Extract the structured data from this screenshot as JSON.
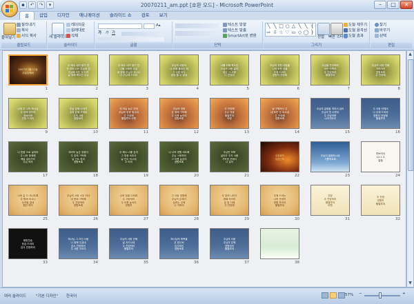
{
  "window": {
    "title": "20070211_am.ppt [호환 모드] - Microsoft PowerPoint",
    "controls": {
      "minimize": "–",
      "maximize": "□",
      "close": "×"
    }
  },
  "quick_access": {
    "save": "▪",
    "undo": "↶",
    "redo": "↷",
    "more": "▾"
  },
  "tabs": [
    "홈",
    "삽입",
    "디자인",
    "애니메이션",
    "슬라이드 쇼",
    "검토",
    "보기"
  ],
  "ribbon": {
    "clipboard": {
      "label": "클립보드",
      "paste": "붙여넣기",
      "cut": "잘라내기",
      "copy": "복사",
      "format_painter": "서식 복사"
    },
    "slides": {
      "label": "슬라이드",
      "new_slide": "새 슬라이드",
      "layout": "레이아웃",
      "reset": "원래대로",
      "delete": "삭제"
    },
    "font": {
      "label": "글꼴",
      "bold": "가",
      "italic": "가",
      "underline": "가"
    },
    "paragraph": {
      "label": "단락",
      "text_direction": "텍스트 방향",
      "align_text": "텍스트 맞춤",
      "smartart": "SmartArt로 변환"
    },
    "drawing": {
      "label": "그리기",
      "arrange": "정렬",
      "quick_styles": "빠른 스타일",
      "shape_fill": "도형 채우기",
      "shape_outline": "도형 윤곽선",
      "shape_effects": "도형 효과"
    },
    "editing": {
      "label": "편집",
      "find": "찾기",
      "replace": "바꾸기",
      "select": "선택"
    }
  },
  "slides": [
    {
      "n": 1,
      "fill": "cross",
      "lines": [
        "2007년 2월 11일",
        "주일낮예배"
      ]
    },
    {
      "n": 2,
      "fill": "yellow",
      "lines": [
        "주 예수 내가 알기 전",
        "전 부터 나는 주님의 것",
        "주님께 모든 것 드려",
        "날 위해 죽으신 주님"
      ]
    },
    {
      "n": 3,
      "fill": "yellow",
      "lines": [
        "주 예수 내가 알기 전",
        "나를 사랑한 주님",
        "내 맘에 주님이 계시니",
        "나 주님께 드리리"
      ]
    },
    {
      "n": 4,
      "fill": "yellow",
      "lines": [
        "주님의 사랑이",
        "나 위해 흘리신 피",
        "그 사랑 모두",
        "감당 할 수 없네"
      ]
    },
    {
      "n": 5,
      "fill": "yellow",
      "lines": [
        "나를 위해 죽으신",
        "주님의 사랑 끝이",
        "없는 그 사랑",
        "나 받았네"
      ]
    },
    {
      "n": 6,
      "fill": "yellow",
      "lines": [
        "주님의 귀한 사랑을",
        "나의 모든 것을",
        "주께 드리리",
        "영원히 찬양해"
      ]
    },
    {
      "n": 7,
      "fill": "yellow",
      "lines": [
        "주님을 찬양하라",
        "모든 민족아",
        "주 찬양하라",
        "할렐루야"
      ]
    },
    {
      "n": 8,
      "fill": "yellow",
      "lines": [
        "주님의 사랑 안에",
        "거하리라",
        "영원토록",
        "주 찬양해"
      ]
    },
    {
      "n": 9,
      "fill": "yellow",
      "lines": [
        "나의 주 나의 하나님",
        "주 앞에 엎드려",
        "경배하며",
        "찬양 드리리"
      ]
    },
    {
      "n": 10,
      "fill": "yellow",
      "lines": [
        "주님 앞에 나아가",
        "주의 은혜 구하리",
        "주의 사랑",
        "영원하리"
      ]
    },
    {
      "n": 11,
      "fill": "orange",
      "lines": [
        "저 하늘 높은 곳에",
        "주님의 영광 빛나리",
        "주 찬양해",
        "할렐루야 아멘"
      ]
    },
    {
      "n": 12,
      "fill": "orange",
      "lines": [
        "주님의 영광",
        "온 땅에 가득해",
        "주 이름 높이리",
        "영원토록"
      ]
    },
    {
      "n": 13,
      "fill": "orange",
      "lines": [
        "주 찬양해",
        "주님 영광",
        "할렐루야",
        "아멘"
      ]
    },
    {
      "n": 14,
      "fill": "orange",
      "lines": [
        "날 구원하신 주",
        "내 모든 것 되시네",
        "주 찬양해",
        "영원토록"
      ]
    },
    {
      "n": 15,
      "fill": "blue",
      "lines": [
        "주님의 말씀을 따라서 살리",
        "주님의 뜻 이루리",
        "주 찬양하며",
        "나아가리라"
      ]
    },
    {
      "n": 16,
      "fill": "blue",
      "lines": [
        "주 사랑 안에서",
        "나 주께 드리리",
        "영원히 찬양해",
        "할렐루야"
      ]
    },
    {
      "n": 17,
      "fill": "green",
      "lines": [
        "나 믿음 으로 살리라",
        "주 나와 함께해",
        "매일 걸어가리",
        "주님 따라"
      ]
    },
    {
      "n": 18,
      "fill": "green",
      "lines": [
        "자비의 높은 영광이",
        "주 앞에 가득해",
        "날 인도 하리",
        "영원토록"
      ]
    },
    {
      "n": 19,
      "fill": "green",
      "lines": [
        "주 예수 나를 깊게",
        "그 영광 비추사",
        "날 인도 하시네",
        "주 따라"
      ]
    },
    {
      "n": 20,
      "fill": "green",
      "lines": [
        "나 나의 영원 되도록",
        "주님 사랑하리",
        "그 이름 높이리",
        "영원토록"
      ]
    },
    {
      "n": 21,
      "fill": "green",
      "lines": [
        "주님만 보며",
        "살리라 주의 사랑",
        "가득한 곳에서",
        "나 살리"
      ]
    },
    {
      "n": 22,
      "fill": "fire",
      "lines": [
        "성경봉독",
        "말씀선포"
      ]
    },
    {
      "n": 23,
      "fill": "sky",
      "lines": [
        "주님이 말씀하시네",
        "",
        "",
        "기쁨의교회"
      ]
    },
    {
      "n": 24,
      "fill": "white",
      "lines": [
        "",
        "히브리서",
        "12:1-3",
        "말씀"
      ]
    },
    {
      "n": 25,
      "fill": "sand",
      "lines": [
        "나의 길 다 지나도록",
        "주 함께 하시니",
        "두려움 없네",
        "평안 하리"
      ]
    },
    {
      "n": 26,
      "fill": "sand",
      "lines": [
        "주님의 사랑 너무 커서",
        "내 맘에 가득해",
        "주 찬양하리",
        "영원토록"
      ]
    },
    {
      "n": 27,
      "fill": "sand",
      "lines": [
        "나의 맘을 다하여",
        "주 사랑하리",
        "주 이름 높이리",
        "영원히"
      ]
    },
    {
      "n": 28,
      "fill": "sand",
      "lines": [
        "그 사랑 영원해",
        "주님의 은혜가",
        "넘치는 곳에",
        "나 거하리"
      ]
    },
    {
      "n": 29,
      "fill": "sand",
      "lines": [
        "주 앞에 나아가",
        "경배 하리라",
        "온 맘 다해",
        "주 찬양해"
      ]
    },
    {
      "n": 30,
      "fill": "sand",
      "lines": [
        "주께 드리는",
        "나의 찬양이",
        "영원 하리라",
        "할렐루야"
      ]
    },
    {
      "n": 31,
      "fill": "cream",
      "lines": [
        "찬양",
        "주 찬양하리",
        "할렐루야",
        "아멘"
      ]
    },
    {
      "n": 32,
      "fill": "cream",
      "lines": [
        "주 찬양",
        "영원히",
        "할렐루야",
        ""
      ]
    },
    {
      "n": 33,
      "fill": "black",
      "lines": [
        "봉헌찬송",
        "헌금 드리리",
        "",
        "감사 찬양하리"
      ]
    },
    {
      "n": 34,
      "fill": "blue",
      "lines": [
        "하나님 그 크신 사랑",
        "나 위해 주셨네",
        "감사 찬양하리",
        "주 사랑 크도다"
      ]
    },
    {
      "n": 35,
      "fill": "blue",
      "lines": [
        "주님의 사랑 안에",
        "날 지키시네",
        "주 찬양하리",
        "할렐루야"
      ]
    },
    {
      "n": 36,
      "fill": "blue",
      "lines": [
        "하나님의 축복을",
        "온 맘으로",
        "감사하리",
        "영원토록"
      ]
    },
    {
      "n": 37,
      "fill": "blue",
      "lines": [
        "주님의 사랑",
        "주님의 은혜",
        "영원하리",
        "할렐루야"
      ]
    },
    {
      "n": 38,
      "fill": "greenwhite",
      "lines": [
        "",
        "",
        "",
        ""
      ]
    }
  ],
  "statusbar": {
    "view": "여러 슬라이드",
    "theme": "\"기본 디자인\"",
    "language": "한국어",
    "zoom": "57%",
    "zoom_minus": "−",
    "zoom_plus": "+"
  },
  "colors": {
    "selection": "#f2a23a",
    "ribbon": "#dde8f6",
    "frame": "#cfdcee"
  }
}
